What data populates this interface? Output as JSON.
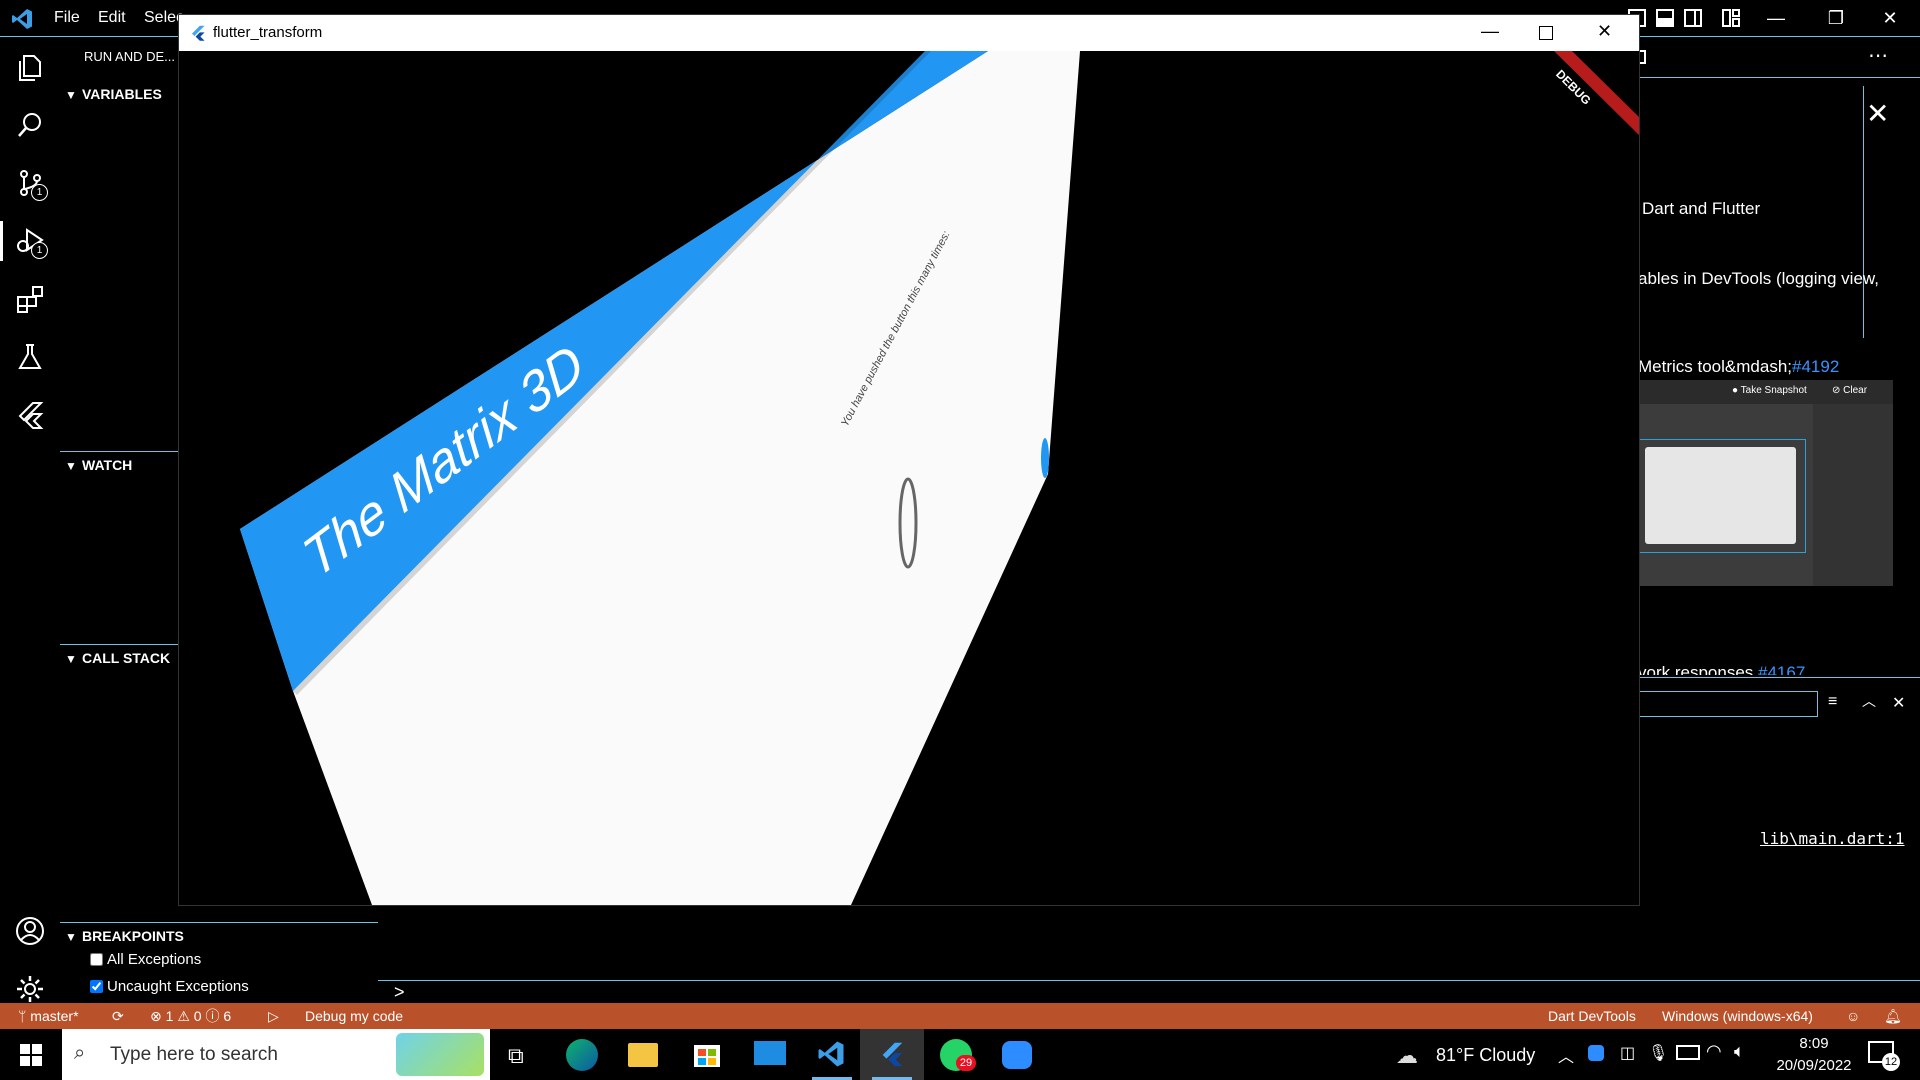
{
  "vscode": {
    "menu": [
      "File",
      "Edit",
      "Selec"
    ],
    "window_controls": {
      "minimize": "—",
      "maximize": "❐",
      "close": "✕"
    },
    "activity_badges": {
      "source_control": "1",
      "run_debug": "1"
    },
    "sidebar": {
      "title": "RUN AND DE...",
      "variables": "VARIABLES",
      "watch": "WATCH",
      "call_stack": "CALL STACK",
      "breakpoints": "BREAKPOINTS",
      "bp_items": [
        {
          "label": "All Exceptions",
          "checked": false
        },
        {
          "label": "Uncaught Exceptions",
          "checked": true
        }
      ]
    },
    "changelog": {
      "line1": "Dart and Flutter",
      "line2": "ables in DevTools (logging view,",
      "line3_prefix": "Metrics tool&mdash;",
      "line3_link": "#4192",
      "line4": "vork responses",
      "line4_link": "#4167",
      "snapshot_btn": "Take Snapshot",
      "clear_btn": "Clear"
    },
    "panel": {
      "link": "lib\\main.dart:1",
      "prompt": ">"
    },
    "statusbar": {
      "branch": "master*",
      "errors": "1",
      "warnings": "0",
      "infos": "6",
      "debug_config": "Debug my code",
      "devtools": "Dart DevTools",
      "device": "Windows (windows-x64)",
      "color": "#b9512a"
    }
  },
  "flutter_window": {
    "title": "flutter_transform",
    "banner": "DEBUG",
    "appbar_title": "The Matrix 3D",
    "body_text": "You have pushed the button this many times:",
    "counter": "0",
    "appbar_color": "#2196f3"
  },
  "taskbar": {
    "search_placeholder": "Type here to search",
    "whatsapp_badge": "29",
    "weather": "81°F  Cloudy",
    "time": "8:09",
    "date": "20/09/2022",
    "notifications": "12"
  }
}
